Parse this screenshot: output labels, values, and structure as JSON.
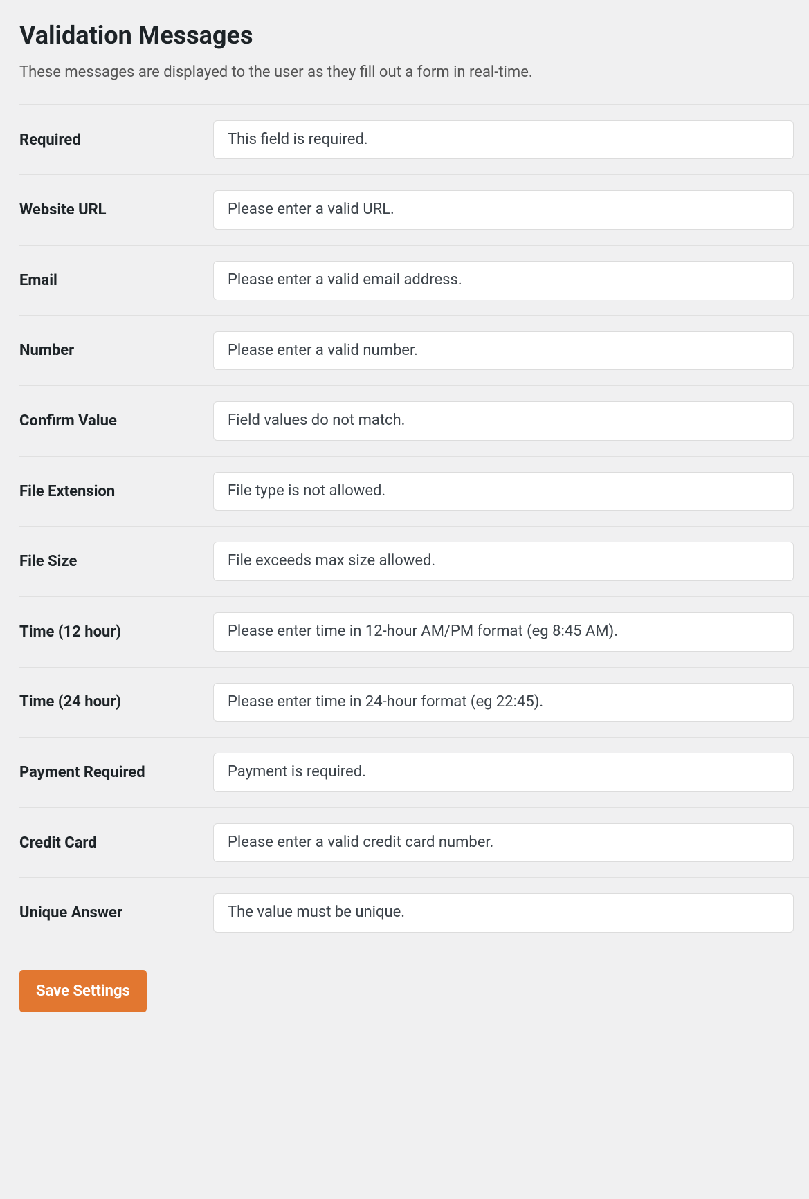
{
  "header": {
    "title": "Validation Messages",
    "description": "These messages are displayed to the user as they fill out a form in real-time."
  },
  "fields": {
    "required": {
      "label": "Required",
      "value": "This field is required."
    },
    "website_url": {
      "label": "Website URL",
      "value": "Please enter a valid URL."
    },
    "email": {
      "label": "Email",
      "value": "Please enter a valid email address."
    },
    "number": {
      "label": "Number",
      "value": "Please enter a valid number."
    },
    "confirm_value": {
      "label": "Confirm Value",
      "value": "Field values do not match."
    },
    "file_extension": {
      "label": "File Extension",
      "value": "File type is not allowed."
    },
    "file_size": {
      "label": "File Size",
      "value": "File exceeds max size allowed."
    },
    "time_12": {
      "label": "Time (12 hour)",
      "value": "Please enter time in 12-hour AM/PM format (eg 8:45 AM)."
    },
    "time_24": {
      "label": "Time (24 hour)",
      "value": "Please enter time in 24-hour format (eg 22:45)."
    },
    "payment_required": {
      "label": "Payment Required",
      "value": "Payment is required."
    },
    "credit_card": {
      "label": "Credit Card",
      "value": "Please enter a valid credit card number."
    },
    "unique_answer": {
      "label": "Unique Answer",
      "value": "The value must be unique."
    }
  },
  "actions": {
    "save_label": "Save Settings"
  }
}
